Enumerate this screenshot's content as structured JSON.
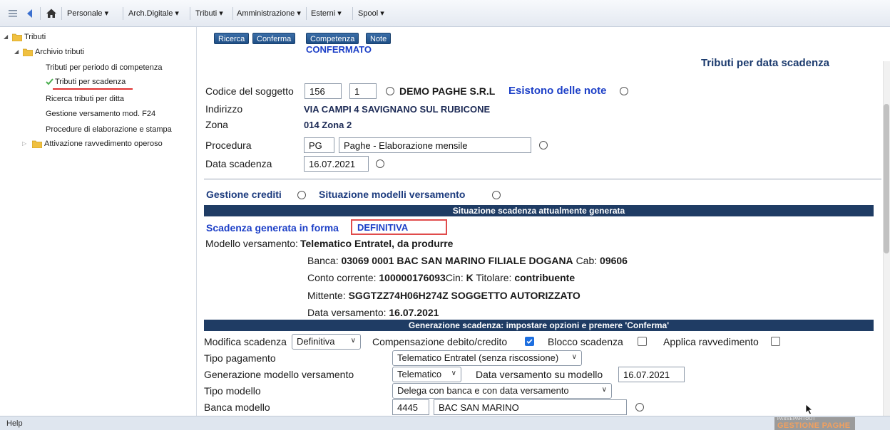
{
  "menubar": {
    "items": [
      "Personale ▾",
      "Arch.Digitale ▾",
      "Tributi ▾",
      "Amministrazione ▾",
      "Esterni ▾",
      "Spool ▾"
    ]
  },
  "tree": {
    "root": "Tributi",
    "archive": "Archivio tributi",
    "items": [
      "Tributi per periodo di competenza",
      "Tributi per scadenza",
      "Ricerca tributi per ditta",
      "Gestione versamento mod. F24",
      "Procedure di elaborazione e stampa"
    ],
    "ravvedimento": "Attivazione ravvedimento operoso"
  },
  "toolbar": {
    "buttons": [
      "Ricerca",
      "Conferma",
      "Competenza",
      "Note"
    ],
    "state": "CONFERMATO"
  },
  "page": {
    "title": "Tributi per data scadenza",
    "codice_label": "Codice del soggetto",
    "codice_value": "156",
    "codice_sub": "1",
    "company": "DEMO PAGHE S.R.L",
    "notes_link": "Esistono delle note",
    "indirizzo_label": "Indirizzo",
    "indirizzo_value": "VIA CAMPI 4 SAVIGNANO SUL RUBICONE",
    "zona_label": "Zona",
    "zona_value": "014  Zona 2",
    "procedura_label": "Procedura",
    "procedura_code": "PG",
    "procedura_desc": "Paghe - Elaborazione mensile",
    "data_scadenza_label": "Data scadenza",
    "data_scadenza_value": "16.07.2021",
    "gestione_crediti": "Gestione crediti",
    "situazione_modelli": "Situazione modelli versamento"
  },
  "situazione": {
    "band": "Situazione scadenza attualmente generata",
    "forma_label": "Scadenza generata in forma",
    "forma_value": "DEFINITIVA",
    "modello_label": "Modello versamento:",
    "modello_value": "Telematico Entratel, da produrre",
    "banca_label": "Banca:",
    "banca_value": "03069 0001 BAC SAN MARINO FILIALE DOGANA",
    "cab_label": "Cab:",
    "cab_value": "09606",
    "conto_label": "Conto corrente:",
    "conto_value": "100000176093",
    "cin_label": "Cin:",
    "cin_value": "K",
    "titolare_label": "Titolare:",
    "titolare_value": "contribuente",
    "mittente_label": "Mittente:",
    "mittente_value": "SGGTZZ74H06H274Z SOGGETTO AUTORIZZATO",
    "data_vers_label": "Data versamento:",
    "data_vers_value": "16.07.2021"
  },
  "generazione": {
    "band": "Generazione scadenza: impostare opzioni e premere 'Conferma'",
    "modifica_label": "Modifica scadenza",
    "modifica_value": "Definitiva",
    "compensazione_label": "Compensazione debito/credito",
    "compensazione_checked": true,
    "blocco_label": "Blocco scadenza",
    "blocco_checked": false,
    "ravvedimento_label": "Applica ravvedimento",
    "ravvedimento_checked": false,
    "tipo_pagamento_label": "Tipo pagamento",
    "tipo_pagamento_value": "Telematico Entratel (senza riscossione)",
    "gen_modello_label": "Generazione modello versamento",
    "gen_modello_value": "Telematico",
    "data_vers_modello_label": "Data versamento su modello",
    "data_vers_modello_value": "16.07.2021",
    "tipo_modello_label": "Tipo modello",
    "tipo_modello_value": "Delega con banca e con data versamento",
    "banca_modello_label": "Banca modello",
    "banca_modello_code": "4445",
    "banca_modello_name": "BAC SAN MARINO"
  },
  "status": {
    "help": "Help",
    "logo_line1": "PASSEPARTOUT",
    "logo_line2": "GESTIONE PAGHE"
  }
}
